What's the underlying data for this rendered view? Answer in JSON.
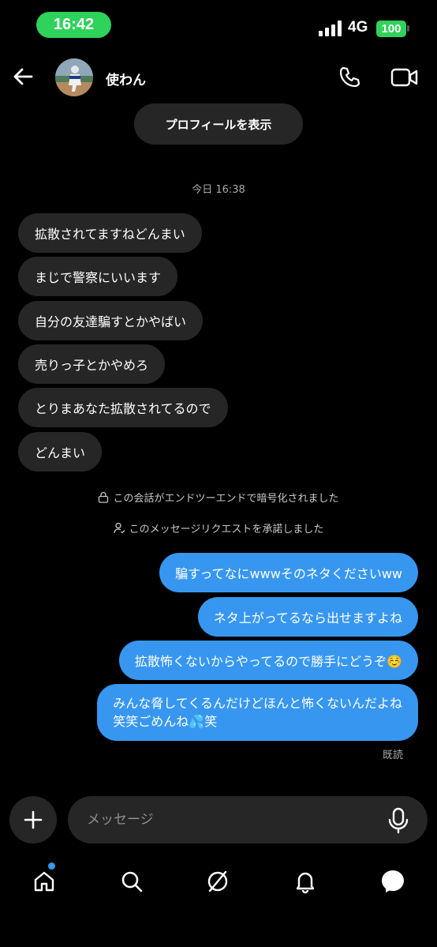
{
  "status_bar": {
    "time": "16:42",
    "network": "4G",
    "battery": "100"
  },
  "header": {
    "user_name": "使わん"
  },
  "profile_button": "プロフィールを表示",
  "timestamp": "今日 16:38",
  "incoming_messages": [
    "拡散されてますねどんまい",
    "まじで警察にいいます",
    "自分の友達騙すとかやばい",
    "売りっ子とかやめろ",
    "とりまあなた拡散されてるので",
    "どんまい"
  ],
  "notices": {
    "encryption": "この会話がエンドツーエンドで暗号化されました",
    "request": "このメッセージリクエストを承諾しました"
  },
  "outgoing_messages": [
    "騙すってなにwwwそのネタくださいww",
    "ネタ上がってるなら出せますよね",
    "拡散怖くないからやってるので勝手にどうぞ☺️",
    "みんな脅してくるんだけどほんと怖くないんだよね",
    "笑笑ごめんね💦笑"
  ],
  "read_receipt": "既読",
  "composer": {
    "placeholder": "メッセージ"
  },
  "colors": {
    "accent": "#3797f0",
    "bubble_in": "#262626",
    "status_green": "#2fd25a"
  },
  "icons": [
    "back-arrow-icon",
    "phone-icon",
    "video-camera-icon",
    "lock-icon",
    "person-check-icon",
    "plus-icon",
    "microphone-icon",
    "home-icon",
    "search-icon",
    "explore-icon",
    "bell-icon",
    "messenger-icon"
  ]
}
